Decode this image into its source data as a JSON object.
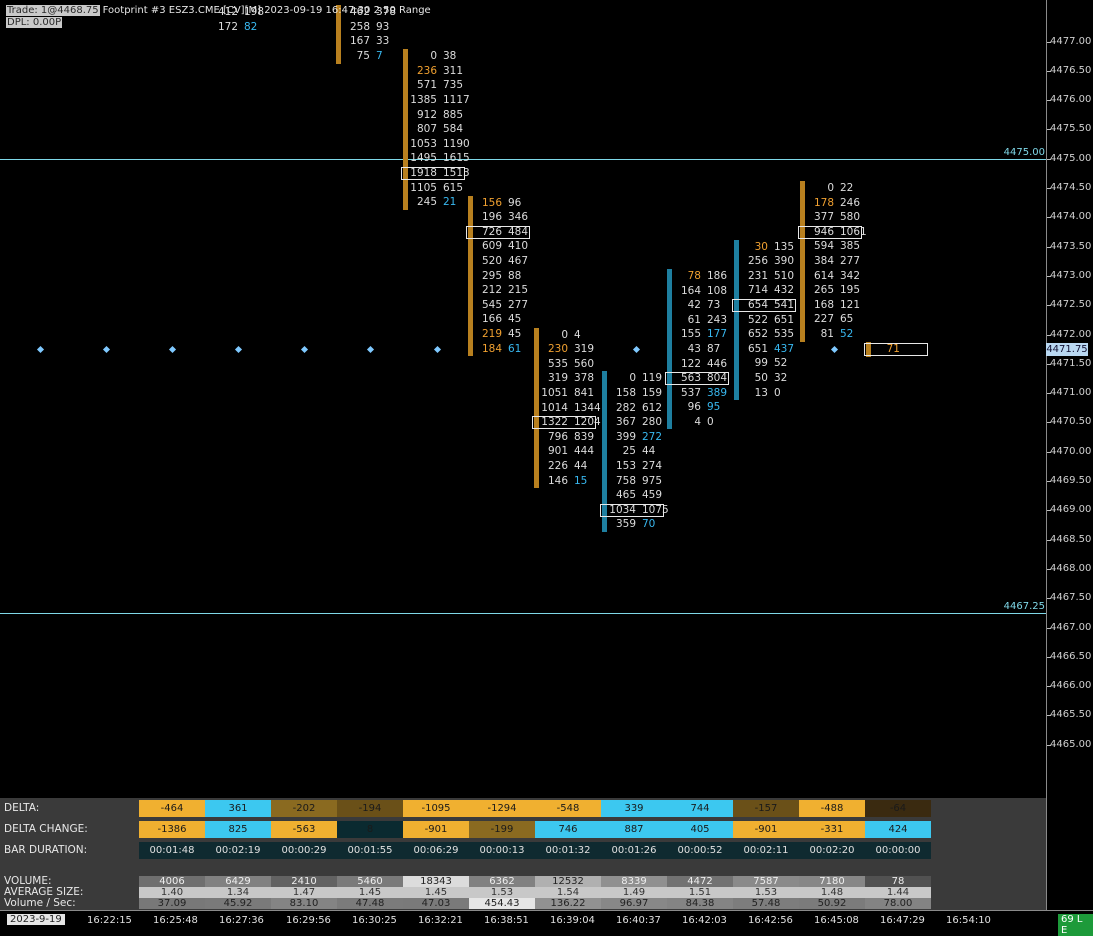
{
  "header": {
    "trade": "Trade: 1@4468.75",
    "title": "Footprint #3 ESZ3.CME [CV][M] 2023-09-19 16:47:30 2.50 Range",
    "dpl": "DPL: 0.00P"
  },
  "colors": {
    "up_bar": "#b8801f",
    "down_bar": "#1e7fa0",
    "bid_ask": "#dcdcdc",
    "highlight_orange": "#f0a030",
    "highlight_blue": "#38b8f0",
    "level_line": "#7fd8e8"
  },
  "price_axis": {
    "labels": [
      "4477.00",
      "4476.50",
      "4476.00",
      "4475.50",
      "4475.00",
      "4474.50",
      "4474.00",
      "4473.50",
      "4473.00",
      "4472.50",
      "4472.00",
      "4471.50",
      "4471.00",
      "4470.50",
      "4470.00",
      "4469.50",
      "4469.00",
      "4468.50",
      "4468.00",
      "4467.50",
      "4467.00",
      "4466.50",
      "4466.00",
      "4465.50",
      "4465.00"
    ],
    "current_price": "4471.75"
  },
  "levels": [
    {
      "price": 4475.0,
      "label": "4475.00"
    },
    {
      "price": 4467.25,
      "label": "4467.25"
    }
  ],
  "bars": [
    {
      "id": "b1",
      "dir": "up",
      "hi": 4477.5,
      "lo": 4477.25,
      "bars_hidden": true,
      "rows": [
        [
          "412",
          "198"
        ],
        [
          "172",
          "82"
        ]
      ],
      "hl": {
        "172": "n",
        "82": "b"
      }
    },
    {
      "id": "b2",
      "dir": "up",
      "hi": 4477.5,
      "lo": 4476.5,
      "rows": [
        [
          "462",
          "378"
        ],
        [
          "258",
          "93"
        ],
        [
          "167",
          "33"
        ],
        [
          "75",
          "7"
        ]
      ],
      "hl_right": [
        3
      ]
    },
    {
      "id": "b3",
      "dir": "up",
      "hi": 4476.75,
      "lo": 4474.5,
      "rows": [
        [
          "0",
          "38"
        ],
        [
          "236",
          "311"
        ],
        [
          "571",
          "735"
        ],
        [
          "1385",
          "1117"
        ],
        [
          "912",
          "885"
        ],
        [
          "807",
          "584"
        ],
        [
          "1053",
          "1190"
        ],
        [
          "1495",
          "1615"
        ],
        [
          "1918",
          "1513"
        ],
        [
          "1105",
          "615"
        ],
        [
          "245",
          "21"
        ]
      ],
      "hl_left": [
        1
      ],
      "hl_right": [
        10
      ],
      "poc": 8
    },
    {
      "id": "b4",
      "dir": "up",
      "hi": 4474.25,
      "lo": 4471.75,
      "rows": [
        [
          "156",
          "96"
        ],
        [
          "196",
          "346"
        ],
        [
          "726",
          "484"
        ],
        [
          "609",
          "410"
        ],
        [
          "520",
          "467"
        ],
        [
          "295",
          "88"
        ],
        [
          "212",
          "215"
        ],
        [
          "545",
          "277"
        ],
        [
          "166",
          "45"
        ],
        [
          "219",
          "45"
        ],
        [
          "184",
          "61"
        ]
      ],
      "hl_left": [
        0,
        9,
        10
      ],
      "hl_right": [
        10
      ],
      "poc": 2
    },
    {
      "id": "b5",
      "dir": "up",
      "hi": 4472.0,
      "lo": 4469.5,
      "rows": [
        [
          "0",
          "4"
        ],
        [
          "230",
          "319"
        ],
        [
          "535",
          "560"
        ],
        [
          "319",
          "378"
        ],
        [
          "1051",
          "841"
        ],
        [
          "1014",
          "1344"
        ],
        [
          "1322",
          "1204"
        ],
        [
          "796",
          "839"
        ],
        [
          "901",
          "444"
        ],
        [
          "226",
          "44"
        ],
        [
          "146",
          "15"
        ]
      ],
      "hl_left": [
        1
      ],
      "hl_right": [
        10
      ],
      "poc": 6
    },
    {
      "id": "b6",
      "dir": "down",
      "hi": 4471.25,
      "lo": 4468.5,
      "rows": [
        [
          "0",
          "119"
        ],
        [
          "158",
          "159"
        ],
        [
          "282",
          "612"
        ],
        [
          "367",
          "280"
        ],
        [
          "399",
          "272"
        ],
        [
          "25",
          "44"
        ],
        [
          "153",
          "274"
        ],
        [
          "758",
          "975"
        ],
        [
          "465",
          "459"
        ],
        [
          "1034",
          "1075"
        ],
        [
          "359",
          "70"
        ]
      ],
      "hl_right": [
        4,
        10
      ],
      "poc": 9
    },
    {
      "id": "b7",
      "dir": "down",
      "hi": 4473.0,
      "lo": 4470.5,
      "rows": [
        [
          "78",
          "186"
        ],
        [
          "164",
          "108"
        ],
        [
          "42",
          "73"
        ],
        [
          "61",
          "243"
        ],
        [
          "155",
          "177"
        ],
        [
          "43",
          "87"
        ],
        [
          "122",
          "446"
        ],
        [
          "563",
          "804"
        ],
        [
          "537",
          "389"
        ],
        [
          "96",
          "95"
        ],
        [
          "4",
          "0"
        ]
      ],
      "hl_left": [
        0
      ],
      "hl_right": [
        4,
        8,
        9
      ],
      "poc": 7
    },
    {
      "id": "b8",
      "dir": "down",
      "hi": 4473.5,
      "lo": 4471.0,
      "rows": [
        [
          "30",
          "135"
        ],
        [
          "256",
          "390"
        ],
        [
          "231",
          "510"
        ],
        [
          "714",
          "432"
        ],
        [
          "654",
          "541"
        ],
        [
          "522",
          "651"
        ],
        [
          "652",
          "535"
        ],
        [
          "651",
          "437"
        ],
        [
          "99",
          "52"
        ],
        [
          "50",
          "32"
        ],
        [
          "13",
          "0"
        ]
      ],
      "hl_left": [
        0
      ],
      "hl_right": [
        7
      ],
      "poc": 4
    },
    {
      "id": "b9",
      "dir": "up",
      "hi": 4474.5,
      "lo": 4472.0,
      "rows": [
        [
          "0",
          "22"
        ],
        [
          "178",
          "246"
        ],
        [
          "377",
          "580"
        ],
        [
          "946",
          "1061"
        ],
        [
          "594",
          "385"
        ],
        [
          "384",
          "277"
        ],
        [
          "614",
          "342"
        ],
        [
          "265",
          "195"
        ],
        [
          "168",
          "121"
        ],
        [
          "227",
          "65"
        ],
        [
          "81",
          "52"
        ]
      ],
      "hl_left": [
        1
      ],
      "hl_right": [
        10
      ],
      "poc": 3
    },
    {
      "id": "b10",
      "dir": "up",
      "hi": 4471.75,
      "lo": 4471.75,
      "rows": [
        [
          "71",
          ""
        ]
      ],
      "hl_left": [
        0
      ],
      "poc": 0
    }
  ],
  "table": {
    "labels": {
      "delta": "DELTA:",
      "delta_change": "DELTA CHANGE:",
      "bar_duration": "BAR DURATION:",
      "volume": "VOLUME:",
      "avg_size": "AVERAGE SIZE:",
      "vol_sec": "Volume / Sec:"
    },
    "delta": [
      "-464",
      "361",
      "-202",
      "-194",
      "-1095",
      "-1294",
      "-548",
      "339",
      "744",
      "-157",
      "-488",
      "-64"
    ],
    "delta_colors": [
      "#f0b030",
      "#3cc8f0",
      "#8a6a20",
      "#6a5018",
      "#f0b030",
      "#f0b030",
      "#f0b030",
      "#3cc8f0",
      "#3cc8f0",
      "#6a5018",
      "#f0b030",
      "#3a2a10"
    ],
    "delta_change": [
      "-1386",
      "825",
      "-563",
      "8",
      "-901",
      "-199",
      "746",
      "887",
      "405",
      "-901",
      "-331",
      "424"
    ],
    "delta_change_colors": [
      "#f0b030",
      "#3cc8f0",
      "#f0b030",
      "#0a2a30",
      "#f0b030",
      "#8a6a20",
      "#3cc8f0",
      "#3cc8f0",
      "#3cc8f0",
      "#f0b030",
      "#f0b030",
      "#3cc8f0"
    ],
    "bar_duration": [
      "00:01:48",
      "00:02:19",
      "00:00:29",
      "00:01:55",
      "00:06:29",
      "00:00:13",
      "00:01:32",
      "00:01:26",
      "00:00:52",
      "00:02:11",
      "00:02:20",
      "00:00:00"
    ],
    "volume": [
      "4006",
      "6429",
      "2410",
      "5460",
      "18343",
      "6362",
      "12532",
      "8339",
      "4472",
      "7587",
      "7180",
      "78"
    ],
    "avg_size": [
      "1.40",
      "1.34",
      "1.47",
      "1.45",
      "1.45",
      "1.53",
      "1.54",
      "1.49",
      "1.51",
      "1.53",
      "1.48",
      "1.44"
    ],
    "vol_sec": [
      "37.09",
      "45.92",
      "83.10",
      "47.48",
      "47.03",
      "454.43",
      "136.22",
      "96.97",
      "84.38",
      "57.48",
      "50.92",
      "78.00"
    ]
  },
  "time_axis": {
    "date": "2023-9-19",
    "labels": [
      "16:22:15",
      "16:25:48",
      "16:27:36",
      "16:29:56",
      "16:30:25",
      "16:32:21",
      "16:38:51",
      "16:39:04",
      "16:40:37",
      "16:42:03",
      "16:42:56",
      "16:45:08",
      "16:47:29",
      "16:54:10"
    ],
    "status": "69 L E"
  }
}
